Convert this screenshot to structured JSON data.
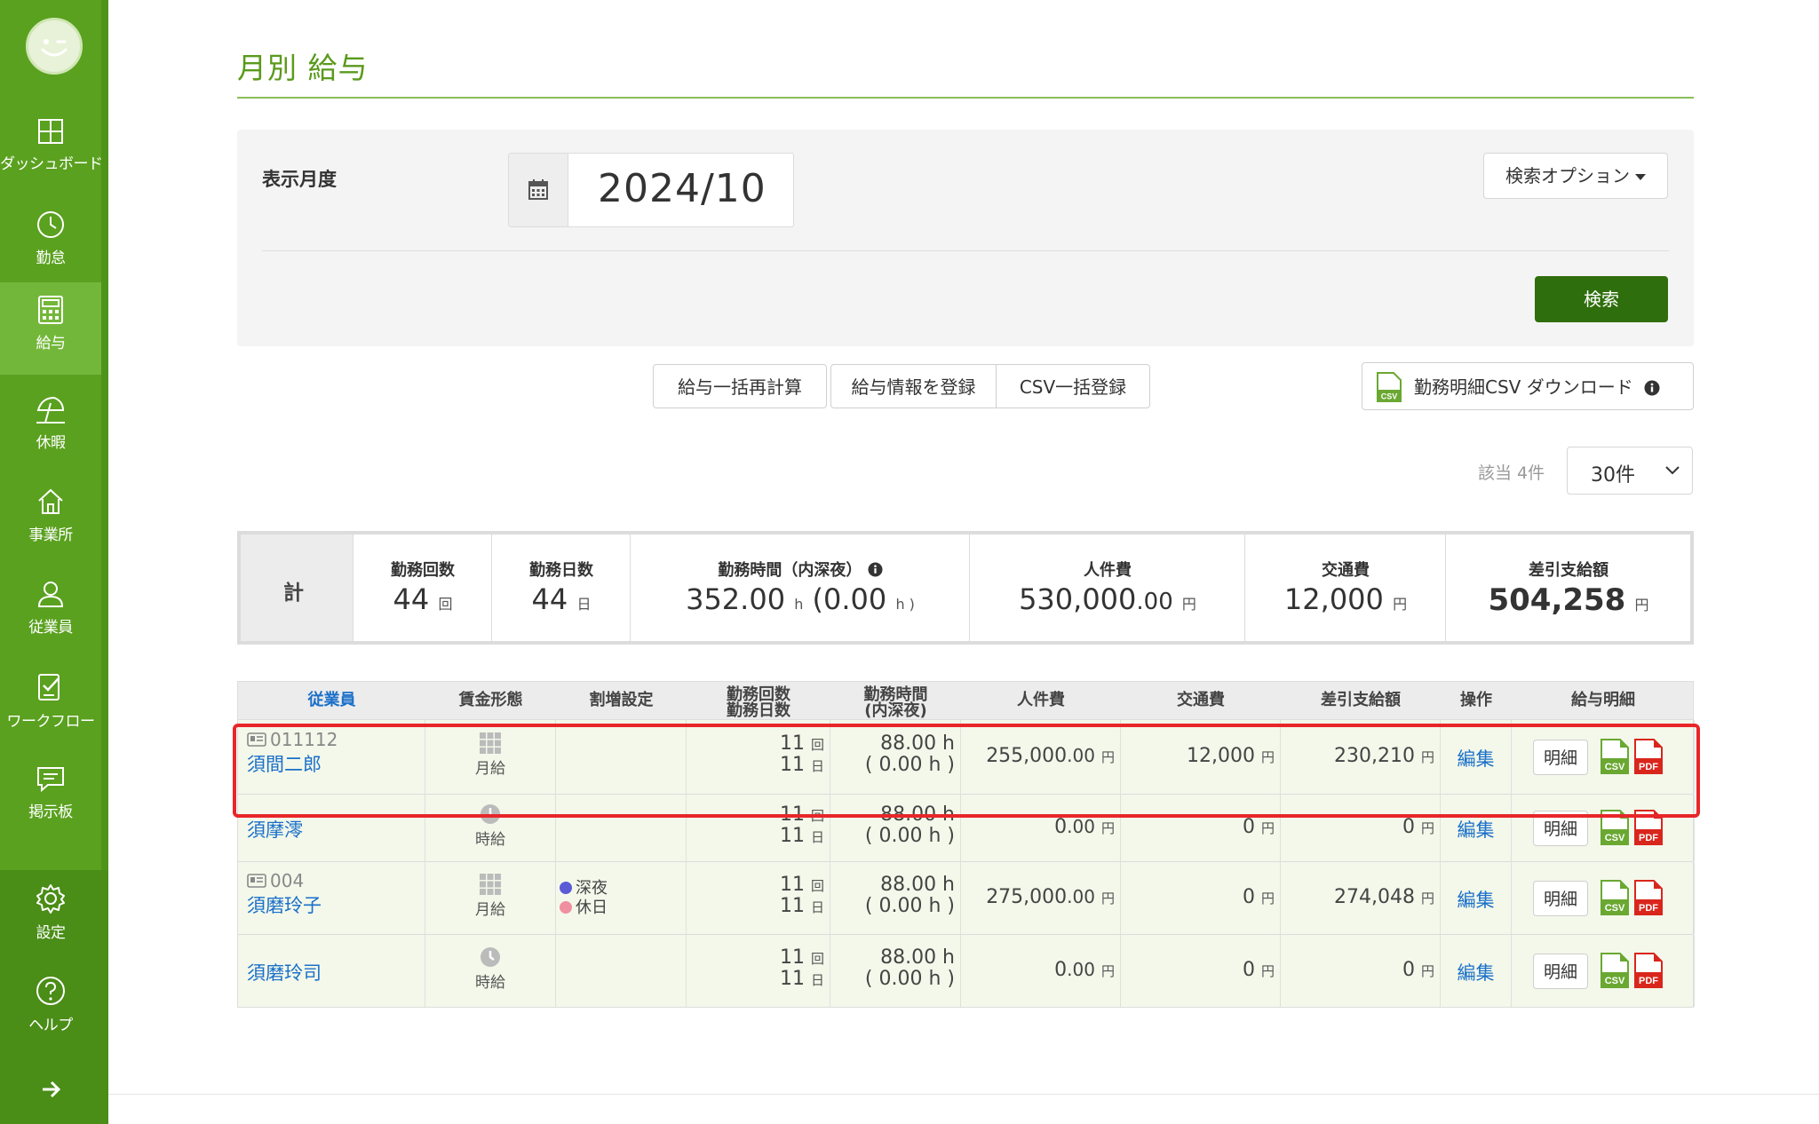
{
  "sidebar": {
    "items": [
      {
        "label": "ダッシュボード",
        "icon": "dashboard-icon"
      },
      {
        "label": "勤怠",
        "icon": "clock-icon"
      },
      {
        "label": "給与",
        "icon": "calculator-icon"
      },
      {
        "label": "休暇",
        "icon": "umbrella-icon"
      },
      {
        "label": "事業所",
        "icon": "home-icon"
      },
      {
        "label": "従業員",
        "icon": "user-icon"
      },
      {
        "label": "ワークフロー",
        "icon": "workflow-icon"
      },
      {
        "label": "掲示板",
        "icon": "chat-icon"
      }
    ],
    "settings_label": "設定",
    "help_label": "ヘルプ",
    "active": "給与"
  },
  "page": {
    "title": "月別 給与"
  },
  "search": {
    "month_label": "表示月度",
    "month_value": "2024/10",
    "options_label": "検索オプション",
    "search_button": "検索"
  },
  "actions": {
    "recalc": "給与一括再計算",
    "register": "給与情報を登録",
    "csv_register": "CSV一括登録",
    "csv_download": "勤務明細CSV ダウンロード"
  },
  "pagination": {
    "count_text": "該当 4件",
    "per_page": "30件"
  },
  "totals": {
    "label": "計",
    "work_count_header": "勤務回数",
    "work_count": "44",
    "work_count_unit": "回",
    "work_days_header": "勤務日数",
    "work_days": "44",
    "work_days_unit": "日",
    "work_hours_header": "勤務時間（内深夜）",
    "work_hours": "352.00",
    "work_hours_unit": "h",
    "work_hours_night_open": "(",
    "work_hours_night": "0.00",
    "work_hours_night_close": "h )",
    "labor_header": "人件費",
    "labor_int": "530,000",
    "labor_dec": ".00",
    "labor_unit": "円",
    "transport_header": "交通費",
    "transport": "12,000",
    "transport_unit": "円",
    "net_header": "差引支給額",
    "net": "504,258",
    "net_unit": "円"
  },
  "table": {
    "headers": {
      "employee": "従業員",
      "wage_type": "賃金形態",
      "overtime": "割増設定",
      "count_days": "勤務回数\n勤務日数",
      "hours": "勤務時間\n(内深夜)",
      "labor": "人件費",
      "transport": "交通費",
      "net": "差引支給額",
      "ops": "操作",
      "payslip": "給与明細"
    },
    "rows": [
      {
        "emp_no": "011112",
        "name": "須間二郎",
        "wage": "月給",
        "wage_icon": "grid-icon",
        "ov1": "",
        "ov2": "",
        "count": "11",
        "count_unit": "回",
        "days": "11",
        "days_unit": "日",
        "hours": "88.00 h",
        "night": "( 0.00 h )",
        "labor_int": "255,000",
        "labor_dec": ".00",
        "transport": "12,000",
        "net": "230,210",
        "yen": "円",
        "edit": "編集",
        "detail": "明細"
      },
      {
        "emp_no": "",
        "name": "須摩澪",
        "wage": "時給",
        "wage_icon": "clock-icon",
        "ov1": "",
        "ov2": "",
        "count": "11",
        "count_unit": "回",
        "days": "11",
        "days_unit": "日",
        "hours": "88.00 h",
        "night": "( 0.00 h )",
        "labor_int": "0",
        "labor_dec": ".00",
        "transport": "0",
        "net": "0",
        "yen": "円",
        "edit": "編集",
        "detail": "明細"
      },
      {
        "emp_no": "004",
        "name": "須磨玲子",
        "wage": "月給",
        "wage_icon": "grid-icon",
        "ov1": "深夜",
        "ov2": "休日",
        "count": "11",
        "count_unit": "回",
        "days": "11",
        "days_unit": "日",
        "hours": "88.00 h",
        "night": "( 0.00 h )",
        "labor_int": "275,000",
        "labor_dec": ".00",
        "transport": "0",
        "net": "274,048",
        "yen": "円",
        "edit": "編集",
        "detail": "明細"
      },
      {
        "emp_no": "",
        "name": "須磨玲司",
        "wage": "時給",
        "wage_icon": "clock-icon",
        "ov1": "",
        "ov2": "",
        "count": "11",
        "count_unit": "回",
        "days": "11",
        "days_unit": "日",
        "hours": "88.00 h",
        "night": "( 0.00 h )",
        "labor_int": "0",
        "labor_dec": ".00",
        "transport": "0",
        "net": "0",
        "yen": "円",
        "edit": "編集",
        "detail": "明細"
      }
    ]
  },
  "file_icons": {
    "csv": "CSV",
    "pdf": "PDF"
  },
  "colors": {
    "sidebar": "#5aa11f",
    "accent": "#2f6e0c",
    "link": "#1a6fc9",
    "highlight": "#e8262a",
    "dot_night": "#5b5bd6",
    "dot_holiday": "#f08fa0"
  }
}
